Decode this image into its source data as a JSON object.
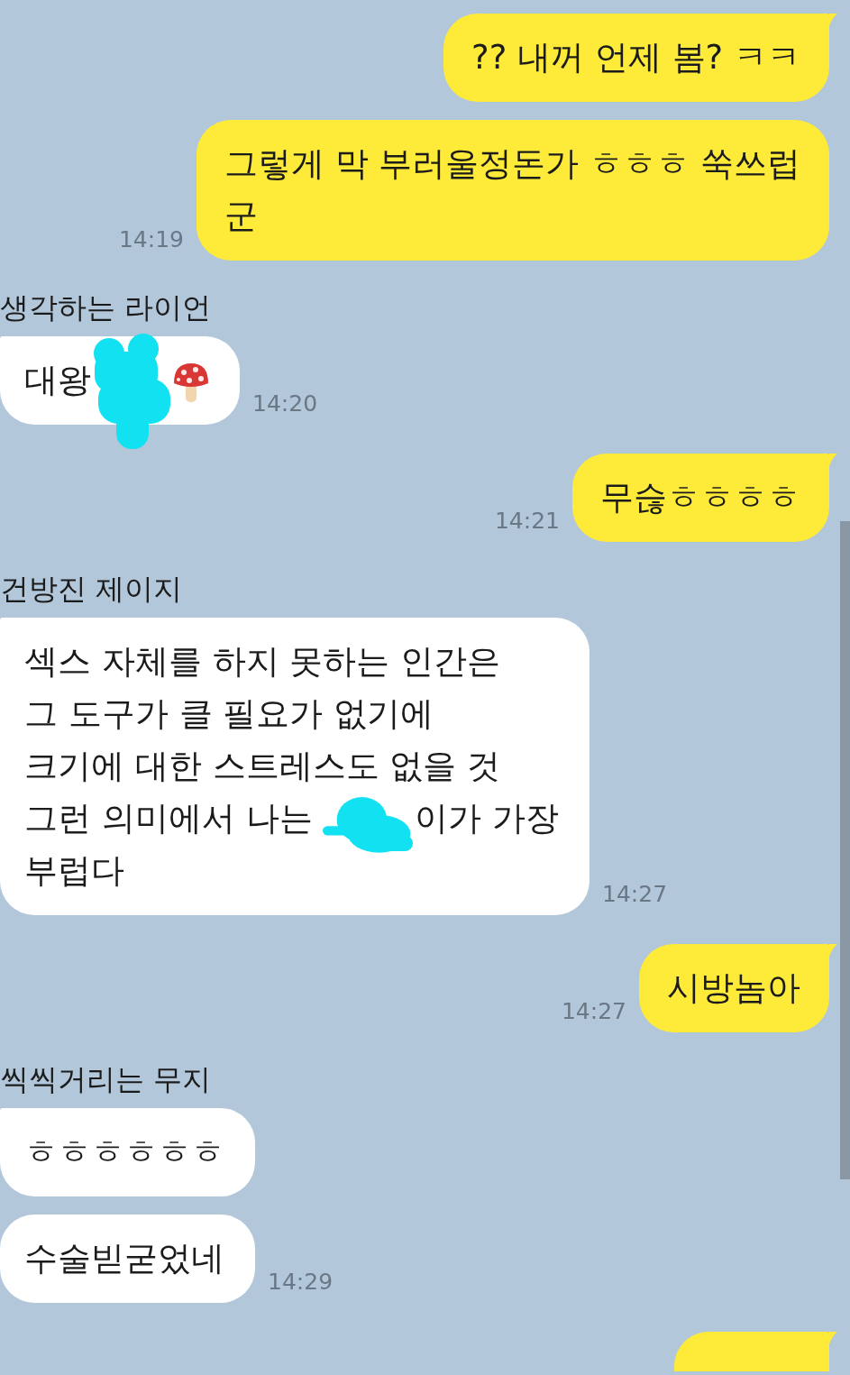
{
  "chat": {
    "groups": [
      {
        "kind": "outgoing",
        "messages": [
          {
            "tail": true,
            "lines": [
              "?? 내꺼 언제 봄? ㅋㅋ"
            ]
          },
          {
            "tail": false,
            "lines": [
              "그렇게 막 부러울정돈가 ㅎㅎㅎ 쑥쓰럽",
              "군"
            ],
            "time": "14:19"
          }
        ]
      },
      {
        "kind": "incoming",
        "sender": "생각하는 라이언",
        "messages": [
          {
            "tail": true,
            "lines": [
              [
                {
                  "kind": "text",
                  "text": "대왕"
                },
                {
                  "kind": "scribble"
                },
                {
                  "kind": "emoji"
                }
              ]
            ],
            "time": "14:20"
          }
        ]
      },
      {
        "kind": "outgoing",
        "messages": [
          {
            "tail": true,
            "lines": [
              "무슪ㅎㅎㅎㅎ"
            ],
            "time": "14:21"
          }
        ]
      },
      {
        "kind": "incoming",
        "sender": "건방진 제이지",
        "messages": [
          {
            "tail": true,
            "lines": [
              "섹스 자체를 하지 못하는 인간은",
              "그 도구가 클 필요가 없기에",
              "크기에 대한 스트레스도 없을 것",
              [
                {
                  "kind": "text",
                  "text": "그런 의미에서 나는 "
                },
                {
                  "kind": "scribble"
                },
                {
                  "kind": "text",
                  "text": "이가 가장"
                }
              ],
              "부럽다"
            ],
            "time": "14:27"
          }
        ]
      },
      {
        "kind": "outgoing",
        "messages": [
          {
            "tail": true,
            "lines": [
              "시방놈아"
            ],
            "time": "14:27"
          }
        ]
      },
      {
        "kind": "incoming",
        "sender": "씩씩거리는 무지",
        "messages": [
          {
            "tail": true,
            "lines": [
              "ㅎㅎㅎㅎㅎㅎ"
            ]
          },
          {
            "tail": false,
            "lines": [
              "수술빋굳었네"
            ],
            "time": "14:29"
          }
        ]
      },
      {
        "kind": "outgoing",
        "messages": [
          {
            "tail": true
          }
        ]
      }
    ]
  }
}
